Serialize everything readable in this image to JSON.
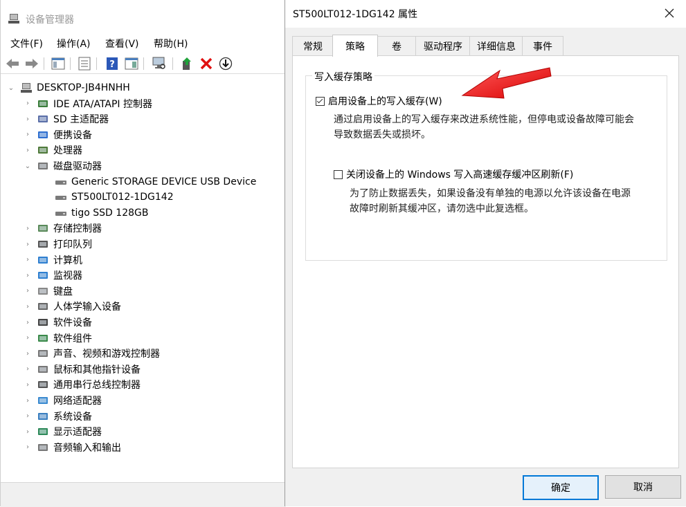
{
  "device_manager": {
    "title": "设备管理器",
    "menu": [
      "文件(F)",
      "操作(A)",
      "查看(V)",
      "帮助(H)"
    ],
    "toolbar_icons": [
      "back-arrow-icon",
      "forward-arrow-icon",
      "show-hide-tree-icon",
      "properties-icon",
      "help-icon",
      "view-icon",
      "scan-hardware-icon",
      "update-driver-icon",
      "uninstall-icon",
      "download-icon"
    ],
    "tree": {
      "root": "DESKTOP-JB4HNHH",
      "items": [
        {
          "label": "IDE ATA/ATAPI 控制器",
          "icon": "ide-controller-icon"
        },
        {
          "label": "SD 主适配器",
          "icon": "sd-adapter-icon"
        },
        {
          "label": "便携设备",
          "icon": "portable-device-icon"
        },
        {
          "label": "处理器",
          "icon": "processor-icon"
        },
        {
          "label": "磁盘驱动器",
          "icon": "disk-drive-icon",
          "expanded": true,
          "children": [
            "Generic STORAGE DEVICE USB Device",
            "ST500LT012-1DG142",
            "tigo SSD 128GB"
          ]
        },
        {
          "label": "存储控制器",
          "icon": "storage-controller-icon"
        },
        {
          "label": "打印队列",
          "icon": "printer-icon"
        },
        {
          "label": "计算机",
          "icon": "computer-icon"
        },
        {
          "label": "监视器",
          "icon": "monitor-icon"
        },
        {
          "label": "键盘",
          "icon": "keyboard-icon"
        },
        {
          "label": "人体学输入设备",
          "icon": "hid-icon"
        },
        {
          "label": "软件设备",
          "icon": "software-device-icon"
        },
        {
          "label": "软件组件",
          "icon": "software-component-icon"
        },
        {
          "label": "声音、视频和游戏控制器",
          "icon": "sound-icon"
        },
        {
          "label": "鼠标和其他指针设备",
          "icon": "mouse-icon"
        },
        {
          "label": "通用串行总线控制器",
          "icon": "usb-icon"
        },
        {
          "label": "网络适配器",
          "icon": "network-adapter-icon"
        },
        {
          "label": "系统设备",
          "icon": "system-device-icon"
        },
        {
          "label": "显示适配器",
          "icon": "display-adapter-icon"
        },
        {
          "label": "音频输入和输出",
          "icon": "audio-io-icon"
        }
      ]
    }
  },
  "dialog": {
    "title": "ST500LT012-1DG142 属性",
    "tabs": [
      "常规",
      "策略",
      "卷",
      "驱动程序",
      "详细信息",
      "事件"
    ],
    "active_tab": "策略",
    "group_title": "写入缓存策略",
    "option1": {
      "label": "启用设备上的写入缓存(W)",
      "checked": true,
      "desc_line1": "通过启用设备上的写入缓存来改进系统性能，但停电或设备故障可能会",
      "desc_line2": "导致数据丢失或损坏。"
    },
    "option2": {
      "label": "关闭设备上的 Windows 写入高速缓存缓冲区刷新(F)",
      "checked": false,
      "desc_line1": "为了防止数据丢失，如果设备没有单独的电源以允许该设备在电源",
      "desc_line2": "故障时刷新其缓冲区，请勿选中此复选框。"
    },
    "ok_label": "确定",
    "cancel_label": "取消"
  },
  "colors": {
    "annotation_arrow": "#ff1a1a",
    "accent": "#0078d7"
  }
}
